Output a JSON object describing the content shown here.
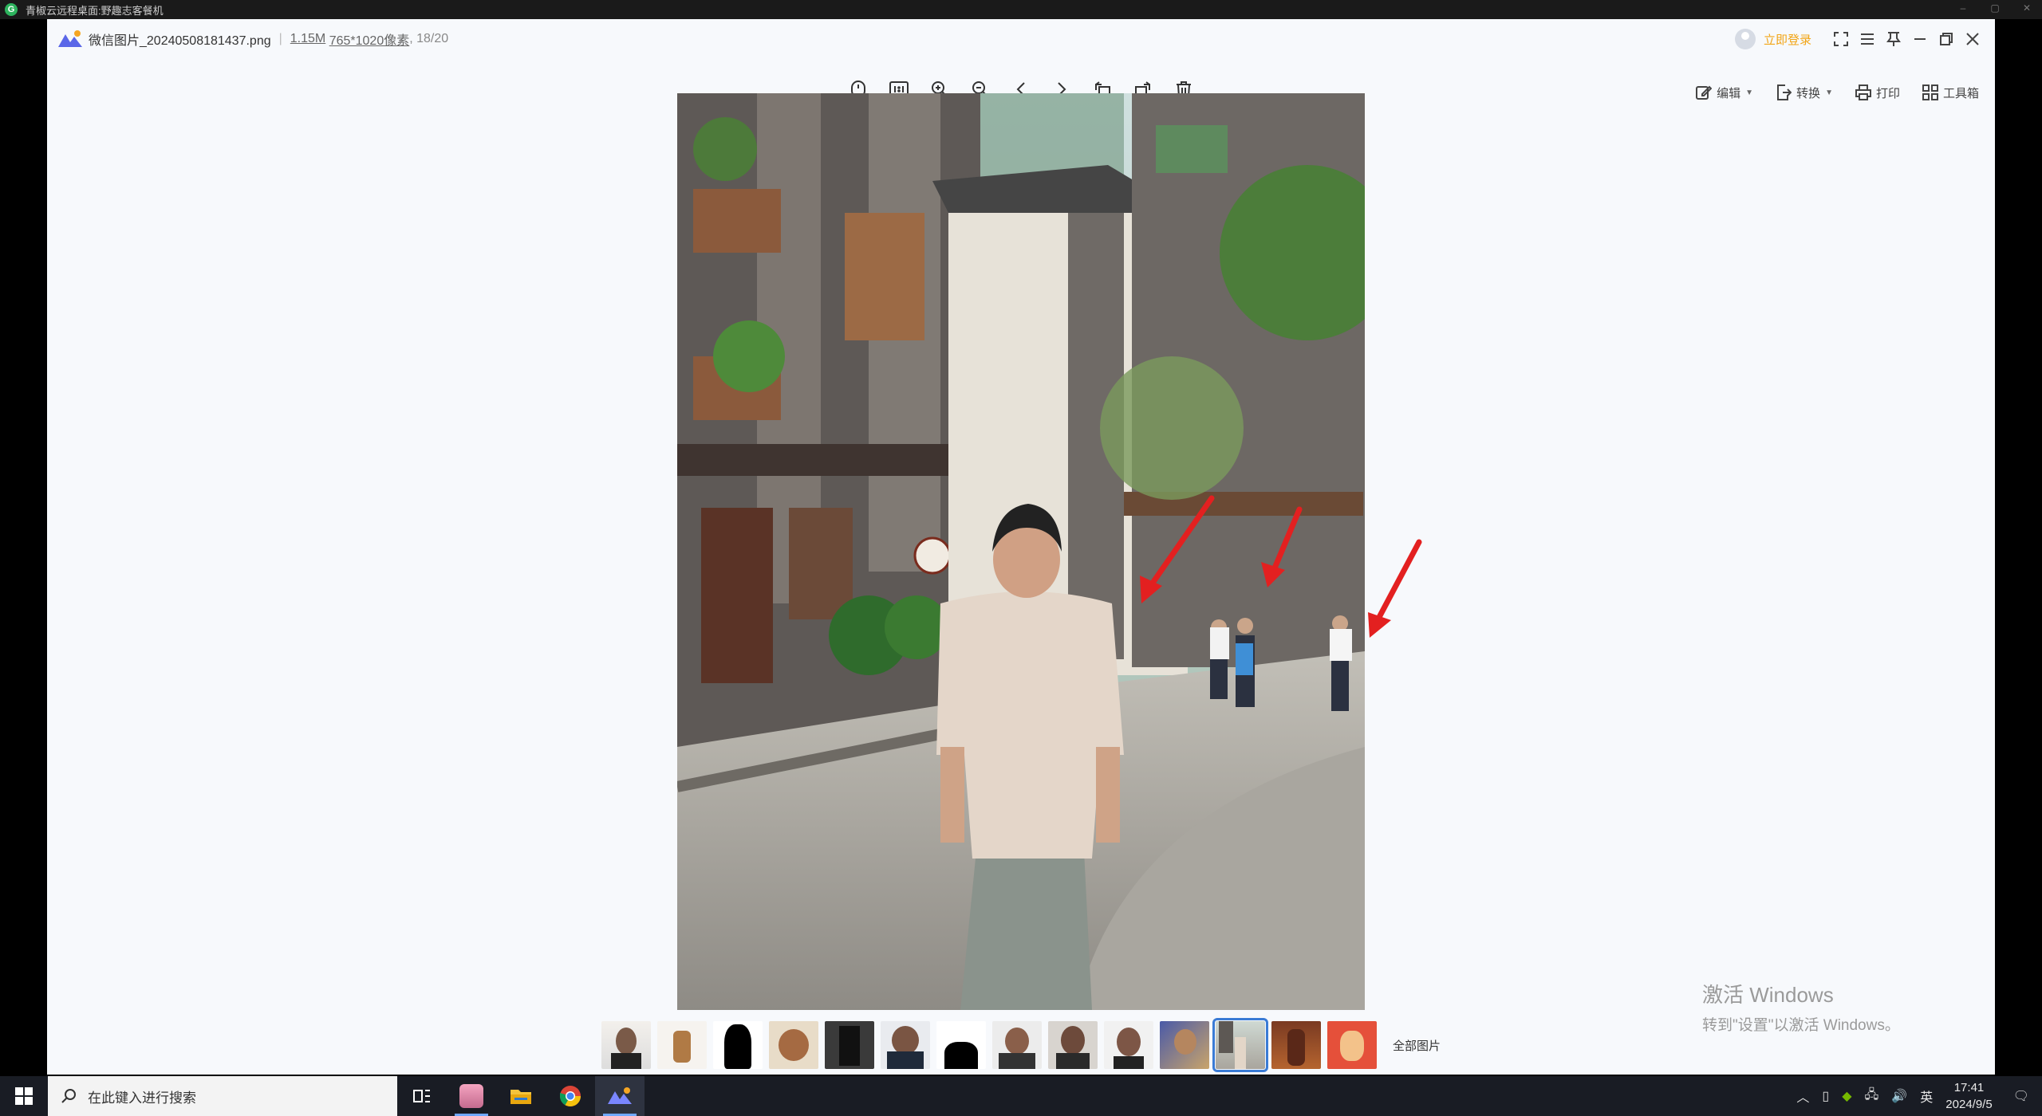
{
  "remote": {
    "title": "青椒云远程桌面:野趣志客餐机",
    "logo_glyph": "G",
    "controls": [
      "–",
      "▢",
      "✕"
    ]
  },
  "viewer": {
    "filename": "微信图片_20240508181437.png",
    "size": "1.15M",
    "dimensions": "765*1020像素",
    "index": "18/20",
    "login_label": "立即登录",
    "toolbar": {
      "edit": "编辑",
      "convert": "转换",
      "print": "打印",
      "toolbox": "工具箱"
    },
    "all_pictures": "全部图片",
    "center_tools": [
      "mouse-icon",
      "actual-size-icon",
      "zoom-in-icon",
      "zoom-out-icon",
      "prev-icon",
      "next-icon",
      "rotate-left-icon",
      "rotate-right-icon",
      "delete-icon"
    ]
  },
  "activation": {
    "line1": "激活 Windows",
    "line2": "转到\"设置\"以激活 Windows。"
  },
  "taskbar": {
    "search_placeholder": "在此键入进行搜索",
    "time": "17:41",
    "date": "2024/9/5",
    "lang": "英"
  },
  "thumbnails_count": 14,
  "selected_thumbnail": 11,
  "colors": {
    "accent": "#3a7bd5",
    "login": "#f2a516",
    "arrow": "#e32020",
    "taskbar": "#191c24"
  }
}
